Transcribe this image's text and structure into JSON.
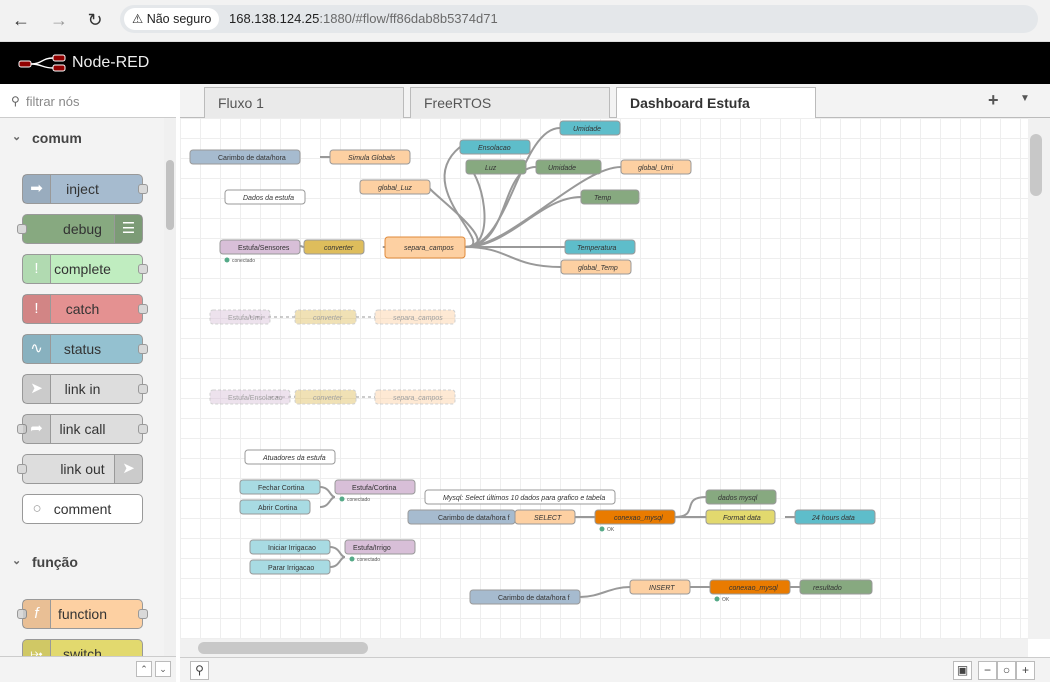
{
  "browser": {
    "security": "Não seguro",
    "url_host": "168.138.124.25",
    "url_rest": ":1880/#flow/ff86dab8b5374d71"
  },
  "app": {
    "title": "Node-RED"
  },
  "palette": {
    "filter_placeholder": "filtrar nós",
    "category_comum": "comum",
    "category_funcao": "função",
    "nodes_comum": [
      "inject",
      "debug",
      "complete",
      "catch",
      "status",
      "link in",
      "link call",
      "link out",
      "comment"
    ],
    "nodes_funcao": [
      "function",
      "switch"
    ]
  },
  "tabs": [
    "Fluxo 1",
    "FreeRTOS",
    "Dashboard Estufa"
  ],
  "flow": {
    "nodes": [
      "Carimbo de data/hora",
      "Simula Globals",
      "Dados da estufa",
      "global_Luz",
      "Estufa/Sensores",
      "conectado",
      "converter",
      "separa_campos",
      "Umidade",
      "Ensolacao",
      "Luz",
      "Umidade",
      "global_Umi",
      "Temp",
      "Temperatura",
      "global_Temp",
      "Estufa/Umi",
      "converter",
      "separa_campos",
      "Estufa/Ensolacao",
      "converter",
      "separa_campos",
      "Atuadores da estufa",
      "Fechar Cortina",
      "Abrir Cortina",
      "Estufa/Cortina",
      "conectado",
      "Mysql: Select últimos 10 dados para grafico e tabela",
      "Carimbo de data/hora f",
      "SELECT",
      "conexao_mysql",
      "OK",
      "dados mysql",
      "Format data",
      "24 hours data",
      "Iniciar Irrigacao",
      "Parar Irrigacao",
      "Estufa/Irrigo",
      "conectado",
      "Carimbo de data/hora f",
      "INSERT",
      "conexao_mysql",
      "OK",
      "resultado"
    ]
  },
  "colors": {
    "inject": "#a6bbcf",
    "debug": "#87a980",
    "complete": "#c0edc0",
    "catch": "#e49191",
    "status": "#94c1d0",
    "link": "#dddddd",
    "comment": "#ffffff",
    "function": "#fdd0a2",
    "switch": "#e2d96e",
    "mqtt": "#d8bfd8",
    "json": "#debd5c",
    "mysql": "#e97b00",
    "dashboard": "#5ebdca"
  }
}
